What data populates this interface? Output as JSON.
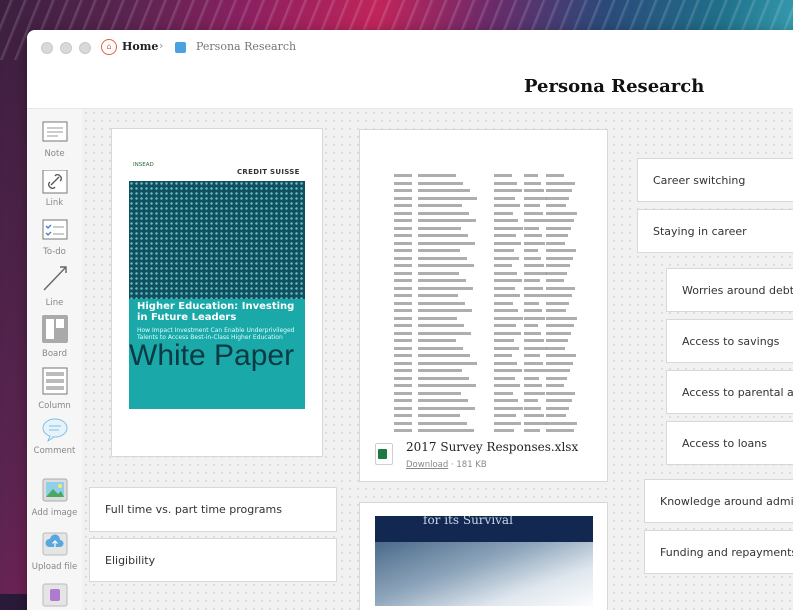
{
  "breadcrumb": {
    "home": "Home",
    "separator": "›",
    "page": "Persona Research"
  },
  "page_title": "Persona Research",
  "toolbar": [
    {
      "label": "Note",
      "icon": "note-icon"
    },
    {
      "label": "Link",
      "icon": "link-icon"
    },
    {
      "label": "To-do",
      "icon": "todo-icon"
    },
    {
      "label": "Line",
      "icon": "line-icon"
    },
    {
      "label": "Board",
      "icon": "board-icon"
    },
    {
      "label": "Column",
      "icon": "column-icon"
    },
    {
      "label": "Comment",
      "icon": "comment-icon"
    },
    {
      "label": "Add image",
      "icon": "image-icon"
    },
    {
      "label": "Upload file",
      "icon": "upload-icon"
    }
  ],
  "white_paper": {
    "brand": "CREDIT SUISSE",
    "logo": "INSEAD",
    "title": "Higher Education: Investing in Future Leaders",
    "subtitle": "How Impact Investment Can Enable Underprivileged Talents to Access Best-in-Class Higher Education",
    "big_text": "White Paper"
  },
  "file_card": {
    "name": "2017 Survey Responses.xlsx",
    "download": "Download",
    "size": "181 KB"
  },
  "image_card": {
    "headline": "for its Survival"
  },
  "text_cards": {
    "full_time": "Full time vs. part time programs",
    "eligibility": "Eligibility",
    "career_switching": "Career switching",
    "staying_in_career": "Staying in career",
    "worries_debt": "Worries around debt",
    "access_savings": "Access to savings",
    "access_parental": "Access to parental assis",
    "access_loans": "Access to loans",
    "knowledge_admission": "Knowledge around admissi",
    "funding_repayments": "Funding and repayments"
  },
  "colors": {
    "accent": "#4aa3e0",
    "excel_green": "#1e7a40",
    "teal": "#1aa8a8"
  }
}
